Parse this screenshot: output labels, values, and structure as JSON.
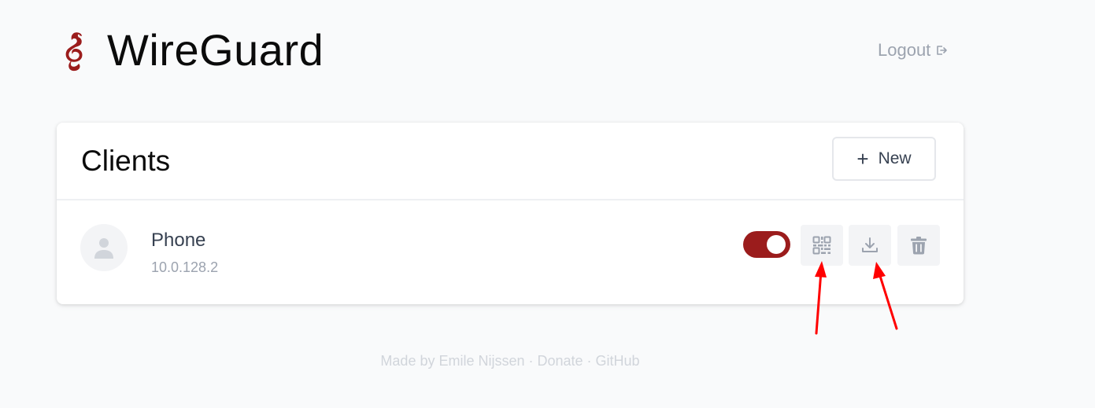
{
  "header": {
    "app_title": "WireGuard",
    "logout_label": "Logout",
    "logo_icon": "wireguard-dragon-logo",
    "logout_icon": "logout-arrow-icon"
  },
  "clients_card": {
    "title": "Clients",
    "new_button_symbol": "+",
    "new_button_label": "New"
  },
  "clients": [
    {
      "name": "Phone",
      "address": "10.0.128.2",
      "enabled": true,
      "avatar_icon": "user-icon",
      "actions": [
        "qr-code-icon",
        "download-icon",
        "trash-icon"
      ]
    }
  ],
  "footer": {
    "made_by": "Made by Emile Nijssen",
    "separator": " · ",
    "donate": "Donate",
    "github": "GitHub"
  },
  "colors": {
    "brand_red": "#9b1c1c",
    "annotation_red": "#ff0000",
    "page_background": "#f9fafb"
  }
}
